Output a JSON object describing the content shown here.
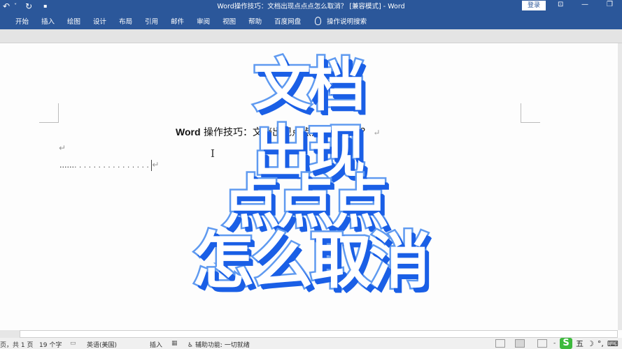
{
  "titlebar": {
    "title": "Word操作技巧：文档出现点点点怎么取消？ [兼容模式] - Word",
    "login_label": "登录",
    "qat": {
      "undo_icon": "↶",
      "undo_dropdown": "˅",
      "redo_icon": "↻",
      "customize": "▪"
    },
    "controls": {
      "ribbon_display": "⊡",
      "minimize": "—",
      "restore": "❐"
    }
  },
  "ribbon": {
    "tabs": [
      "开始",
      "插入",
      "绘图",
      "设计",
      "布局",
      "引用",
      "邮件",
      "审阅",
      "视图",
      "帮助",
      "百度网盘"
    ],
    "tell_me": "操作说明搜索"
  },
  "document": {
    "title_bold": "Word",
    "title_rest": " 操作技巧：文档出现点点点怎么取消？",
    "para_mark": "↵",
    "dots_solid": "......",
    "dots_leader": "................"
  },
  "overlay": {
    "lines": [
      "文档",
      "出现",
      "点点点",
      "怎么取消"
    ],
    "colors": {
      "fill": "#ffffff",
      "stroke": "#5f9af0",
      "shadow": "#1a5fe6"
    }
  },
  "statusbar": {
    "page": "页，共 1 页",
    "words": "19 个字",
    "language": "英语(美国)",
    "mode": "插入",
    "accessibility": "辅助功能: 一切就绪",
    "zoom_minus": "-"
  },
  "ime": {
    "logo": "S",
    "mode": "五",
    "moon": "☽",
    "punct": "°,",
    "keyboard": "⌨"
  }
}
